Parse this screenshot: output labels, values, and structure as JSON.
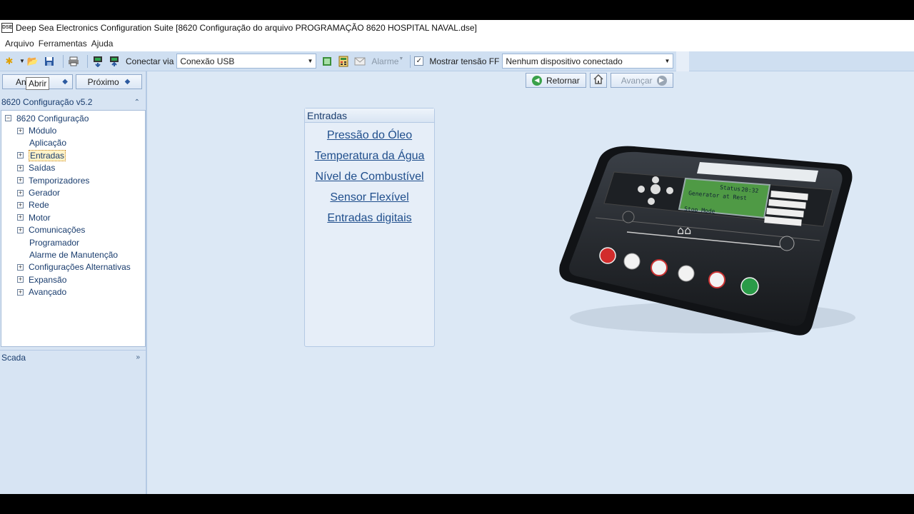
{
  "window": {
    "icon_text": "DSE",
    "title": "Deep Sea Electronics Configuration Suite [8620 Configuração do arquivo PROGRAMAÇÃO 8620 HOSPITAL NAVAL.dse]"
  },
  "menu": {
    "items": [
      "Arquivo",
      "Ferramentas",
      "Ajuda"
    ]
  },
  "toolbar": {
    "connect_label": "Conectar via",
    "connection_value": "Conexão USB",
    "alarm_label": "Alarme",
    "show_voltage_label": "Mostrar tensão FF",
    "show_voltage_checked": true,
    "device_value": "Nenhum dispositivo conectado"
  },
  "leftnav": {
    "back_label": "Anterior",
    "next_label": "Próximo",
    "tooltip": "Abrir"
  },
  "tree": {
    "header": "8620 Configuração v5.2",
    "root": "8620 Configuração",
    "items": [
      {
        "label": "Módulo",
        "expandable": true
      },
      {
        "label": "Aplicação",
        "expandable": false
      },
      {
        "label": "Entradas",
        "expandable": true,
        "selected": true
      },
      {
        "label": "Saídas",
        "expandable": true
      },
      {
        "label": "Temporizadores",
        "expandable": true
      },
      {
        "label": "Gerador",
        "expandable": true
      },
      {
        "label": "Rede",
        "expandable": true
      },
      {
        "label": "Motor",
        "expandable": true
      },
      {
        "label": "Comunicações",
        "expandable": true
      },
      {
        "label": "Programador",
        "expandable": false
      },
      {
        "label": "Alarme de Manutenção",
        "expandable": false
      },
      {
        "label": "Configurações Alternativas",
        "expandable": true
      },
      {
        "label": "Expansão",
        "expandable": true
      },
      {
        "label": "Avançado",
        "expandable": true
      }
    ]
  },
  "scada": {
    "header": "Scada"
  },
  "mainnav": {
    "back_label": "Retornar",
    "forward_label": "Avançar"
  },
  "panel": {
    "title": "Entradas",
    "links": [
      "Pressão do Óleo",
      "Temperatura da Água",
      "Nível de Combustível",
      "Sensor Flexível",
      "Entradas digitais"
    ]
  },
  "device_screen": {
    "lines": [
      "Status",
      "20:32",
      "Generator at Rest",
      "Stop Mode"
    ]
  }
}
